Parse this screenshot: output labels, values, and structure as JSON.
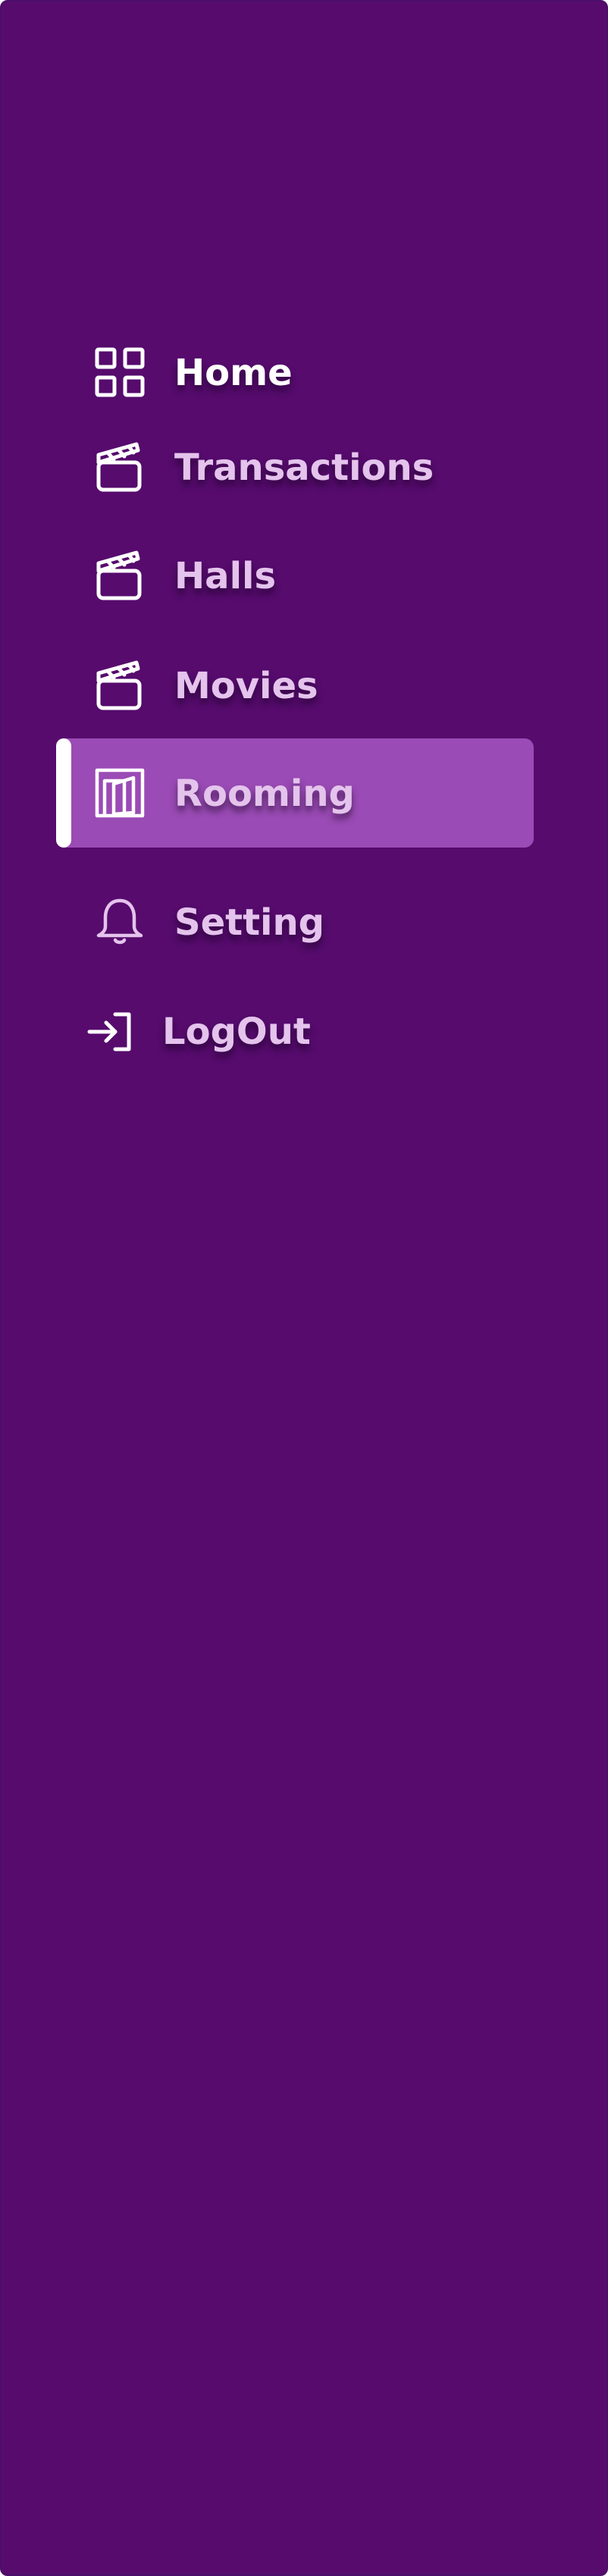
{
  "theme": {
    "background": "#560b6d",
    "accent": "#9a4bb5",
    "text": "#e4c3ec",
    "icon": "#ffffff"
  },
  "sidebar": {
    "items": [
      {
        "label": "Home",
        "icon": "grid-icon",
        "active": false
      },
      {
        "label": "Transactions",
        "icon": "clapperboard-icon",
        "active": false
      },
      {
        "label": "Halls",
        "icon": "clapperboard-icon",
        "active": false
      },
      {
        "label": "Movies",
        "icon": "clapperboard-icon",
        "active": false
      },
      {
        "label": "Rooming",
        "icon": "door-open-icon",
        "active": true
      },
      {
        "label": "Setting",
        "icon": "bell-icon",
        "active": false
      },
      {
        "label": "LogOut",
        "icon": "login-arrow-icon",
        "active": false
      }
    ]
  }
}
